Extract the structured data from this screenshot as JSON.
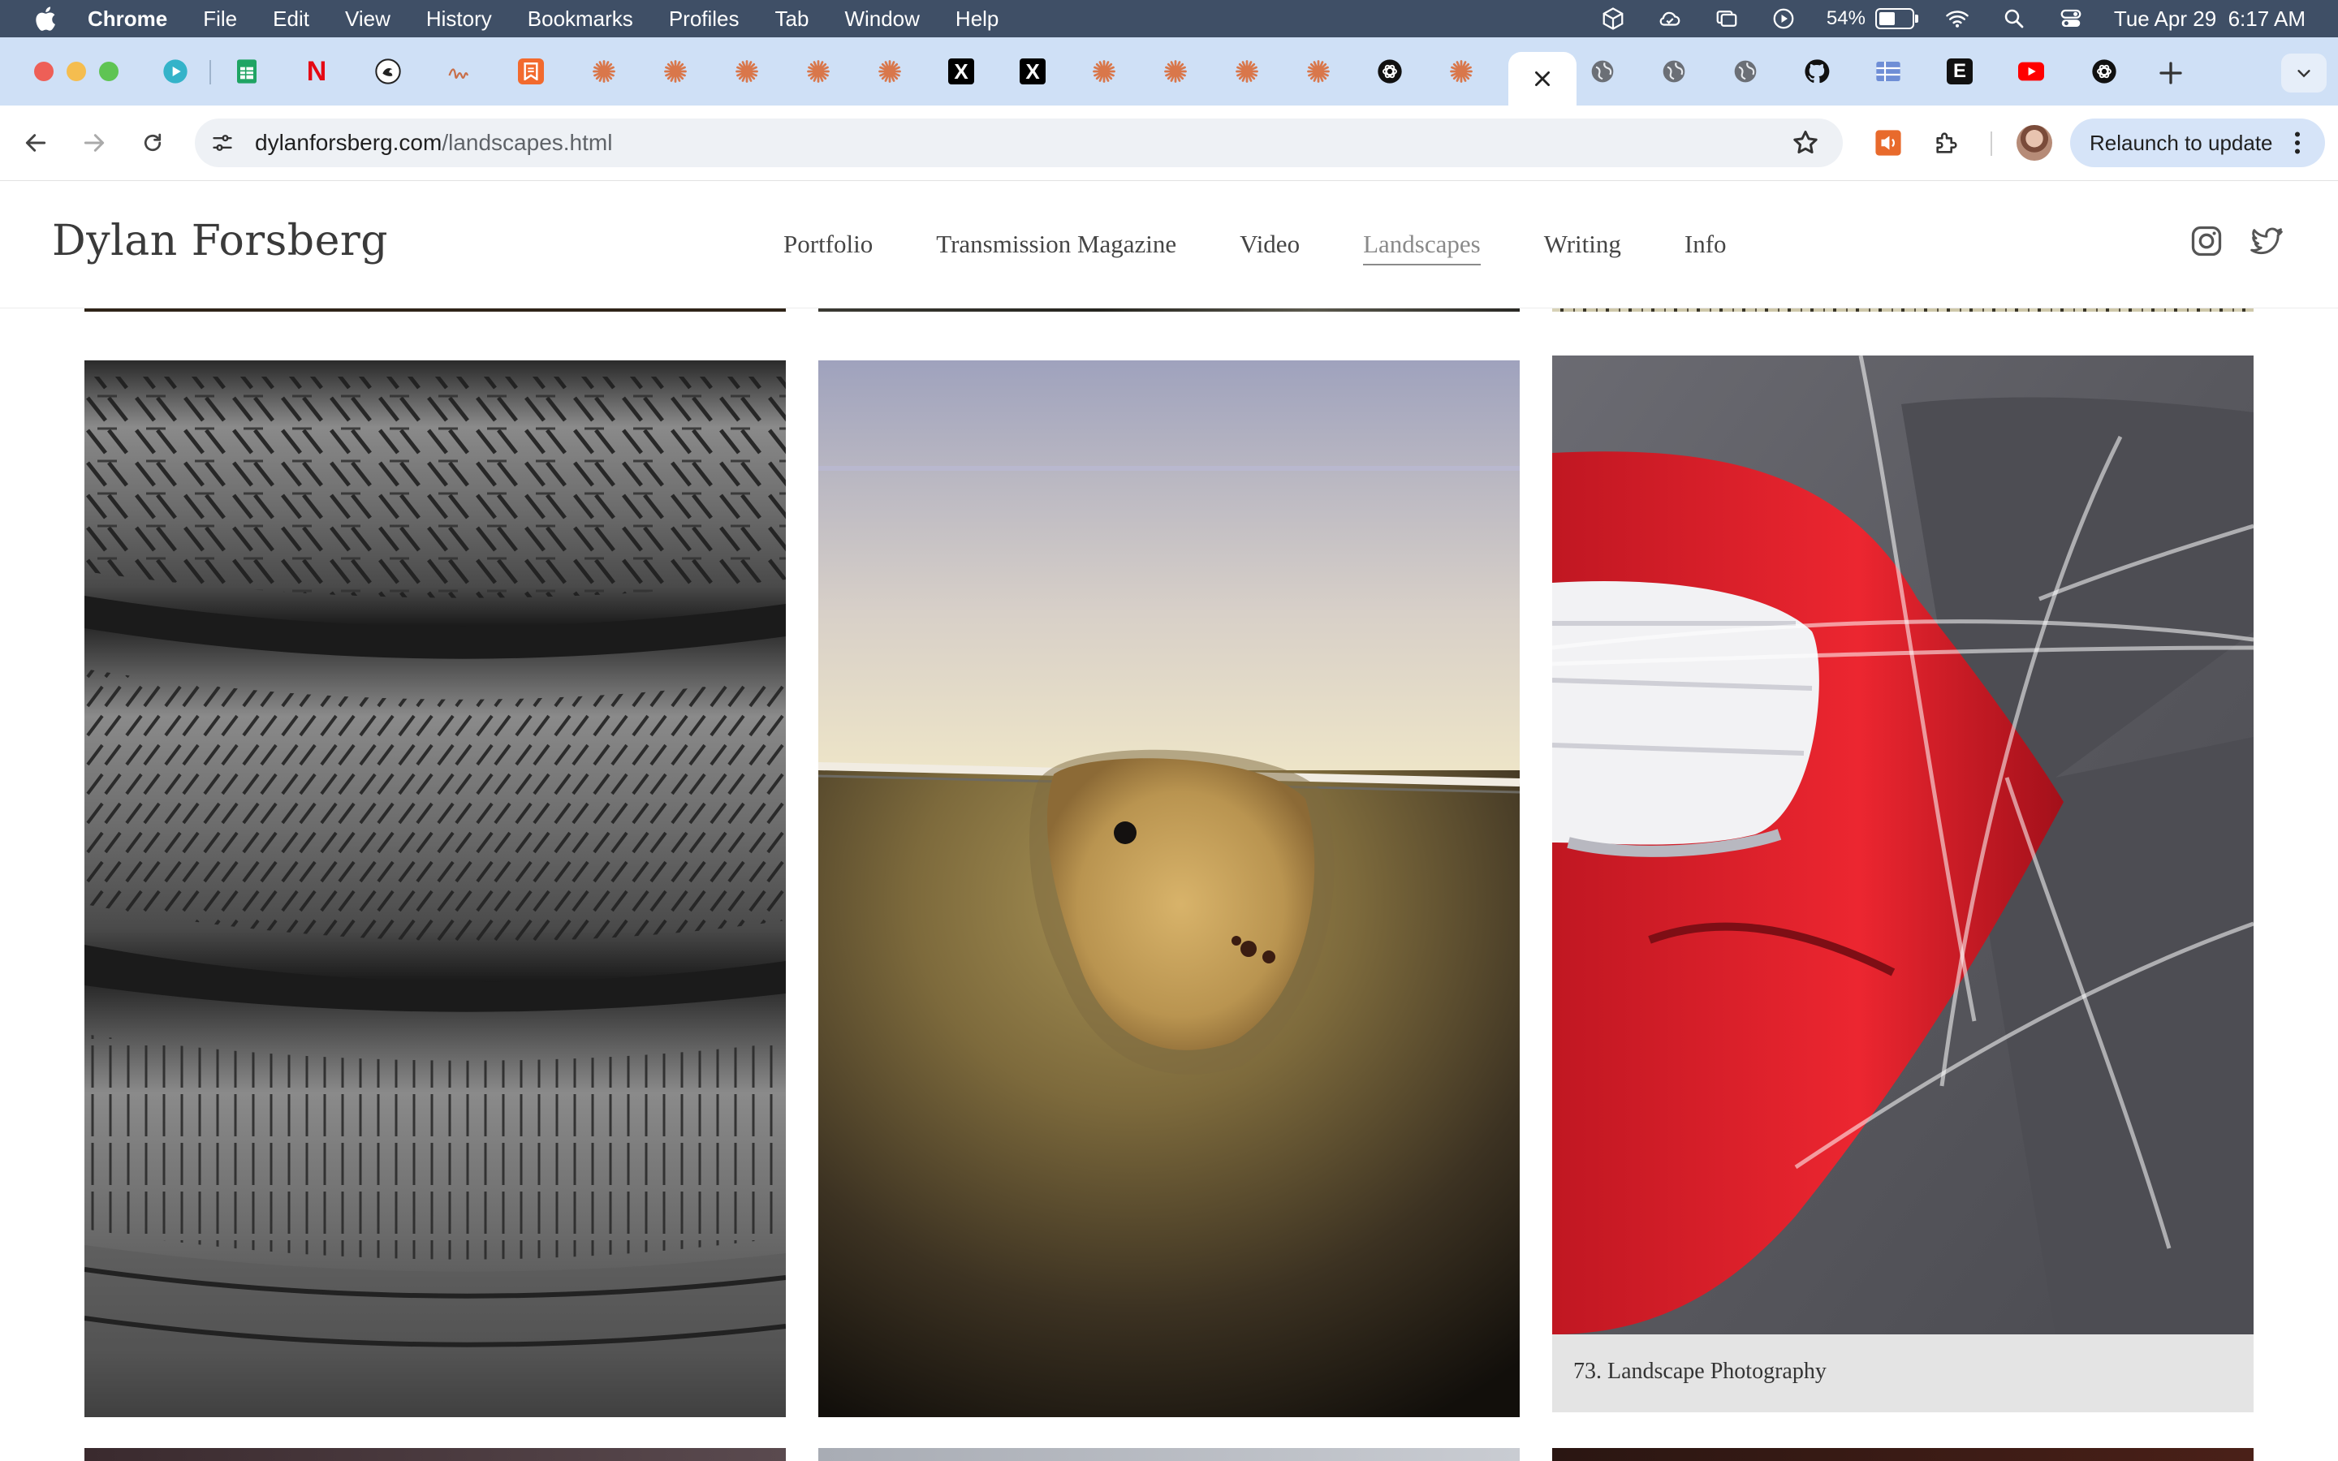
{
  "menubar": {
    "app_name": "Chrome",
    "items": [
      "File",
      "Edit",
      "View",
      "History",
      "Bookmarks",
      "Profiles",
      "Tab",
      "Window",
      "Help"
    ],
    "battery_percent": "54%",
    "battery_level": 0.54,
    "datetime": "Tue Apr 29  6:17 AM"
  },
  "tabs": {
    "favicons": [
      "play-icon",
      "sheets-icon",
      "netflix-icon",
      "bird-logo-icon",
      "squiggle-icon",
      "bookmark-app-icon",
      "asterisk-icon",
      "asterisk-icon",
      "asterisk-icon",
      "asterisk-icon",
      "asterisk-icon",
      "x-icon",
      "x-icon",
      "asterisk-icon",
      "asterisk-icon",
      "asterisk-icon",
      "asterisk-icon",
      "openai-icon",
      "asterisk-icon",
      "close-icon",
      "globe-icon",
      "globe-icon",
      "globe-icon",
      "github-icon",
      "layout-icon",
      "e-icon",
      "youtube-icon",
      "openai-icon"
    ],
    "x_letter": "X",
    "e_letter": "E",
    "n_letter": "N"
  },
  "toolbar": {
    "url_host": "dylanforsberg.com",
    "url_path": "/landscapes.html",
    "relaunch_label": "Relaunch to update"
  },
  "site": {
    "title": "Dylan Forsberg",
    "nav": [
      "Portfolio",
      "Transmission Magazine",
      "Video",
      "Landscapes",
      "Writing",
      "Info"
    ],
    "current_nav": "Landscapes"
  },
  "gallery": {
    "caption": "73. Landscape Photography",
    "photos": [
      "stacked-tires-photo",
      "rust-patch-photo",
      "taped-tail-light-photo"
    ]
  },
  "colors": {
    "menubar": "#3f4f66",
    "tabstrip": "#cfe0f6",
    "relaunch": "#d6e4f8",
    "tail_light_red": "#e8232b"
  }
}
